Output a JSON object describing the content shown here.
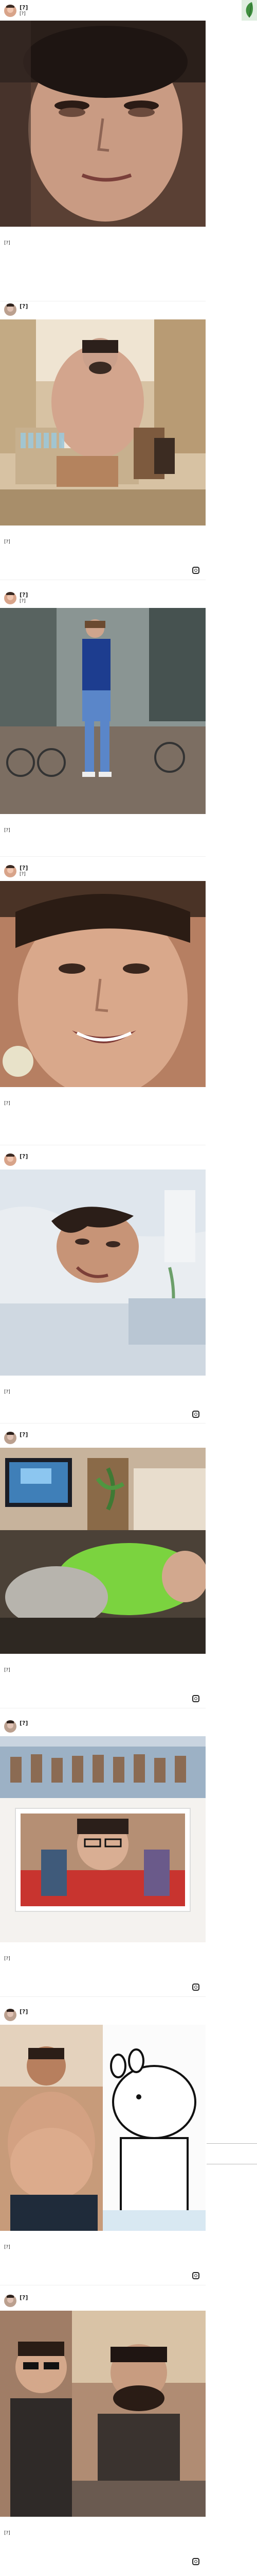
{
  "ui": {
    "follow_label": "",
    "verified_like_prefix": "♥"
  },
  "posts": [
    {
      "id": "p1",
      "username": "[?]",
      "location": "[?]",
      "likes": "",
      "comments": "",
      "caption": "[?]",
      "time": ""
    },
    {
      "id": "p2",
      "username": "[?]",
      "location": "",
      "likes": "",
      "comments": "",
      "caption": "[?]",
      "time": ""
    },
    {
      "id": "p3",
      "username": "[?]",
      "location": "[?]",
      "likes": "",
      "comments": "",
      "caption": "[?]",
      "time": ""
    },
    {
      "id": "p4",
      "username": "[?]",
      "location": "[?]",
      "likes": "",
      "comments": "",
      "caption": "[?]",
      "time": ""
    },
    {
      "id": "p5",
      "username": "[?]",
      "location": "",
      "likes": "",
      "comments": "",
      "caption": "[?]",
      "time": ""
    },
    {
      "id": "p6",
      "username": "[?]",
      "location": "",
      "likes": "",
      "comments": "",
      "caption": "[?]",
      "time": ""
    },
    {
      "id": "p7",
      "username": "[?]",
      "location": "",
      "likes": "",
      "comments": "",
      "caption": "[?]",
      "time": ""
    },
    {
      "id": "p8",
      "username": "[?]",
      "location": "",
      "likes": "",
      "comments": "",
      "caption": "[?]",
      "time": ""
    },
    {
      "id": "p9",
      "username": "[?]",
      "location": "",
      "likes": "",
      "comments": "",
      "caption": "[?]",
      "time": ""
    }
  ]
}
